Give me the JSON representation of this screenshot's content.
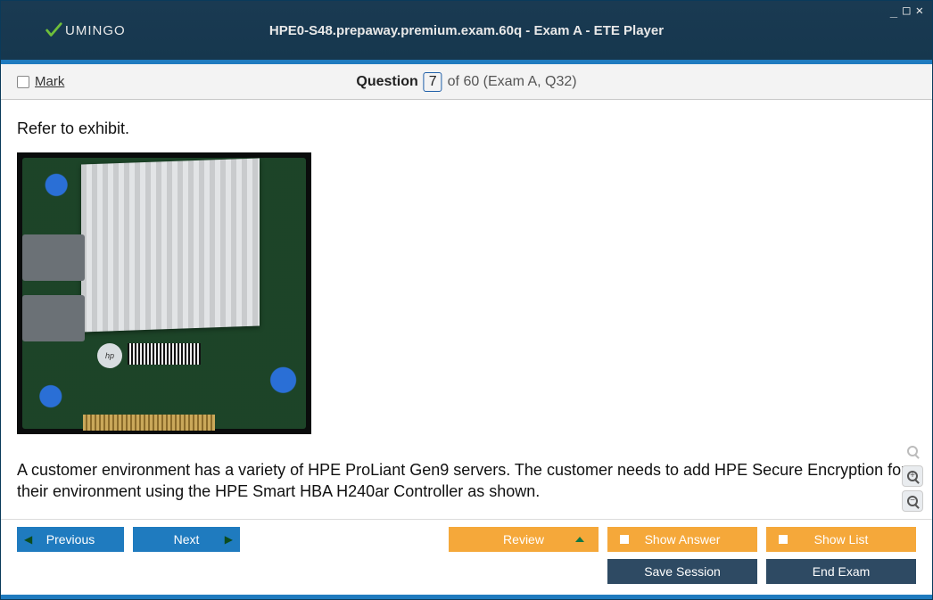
{
  "window": {
    "logo_text": "UMINGO",
    "title": "HPE0-S48.prepaway.premium.exam.60q - Exam A - ETE Player"
  },
  "question_bar": {
    "mark_label": "Mark",
    "question_word": "Question",
    "current_number": "7",
    "of_text": "of 60 (Exam A, Q32)"
  },
  "content": {
    "intro": "Refer to exhibit.",
    "body": "A customer environment has a variety of HPE ProLiant Gen9 servers. The customer needs to add HPE Secure Encryption for their environment using the HPE Smart HBA H240ar Controller as shown."
  },
  "exhibit": {
    "hp_label": "hp"
  },
  "footer": {
    "previous": "Previous",
    "next": "Next",
    "review": "Review",
    "show_answer": "Show Answer",
    "show_list": "Show List",
    "save_session": "Save Session",
    "end_exam": "End Exam"
  }
}
